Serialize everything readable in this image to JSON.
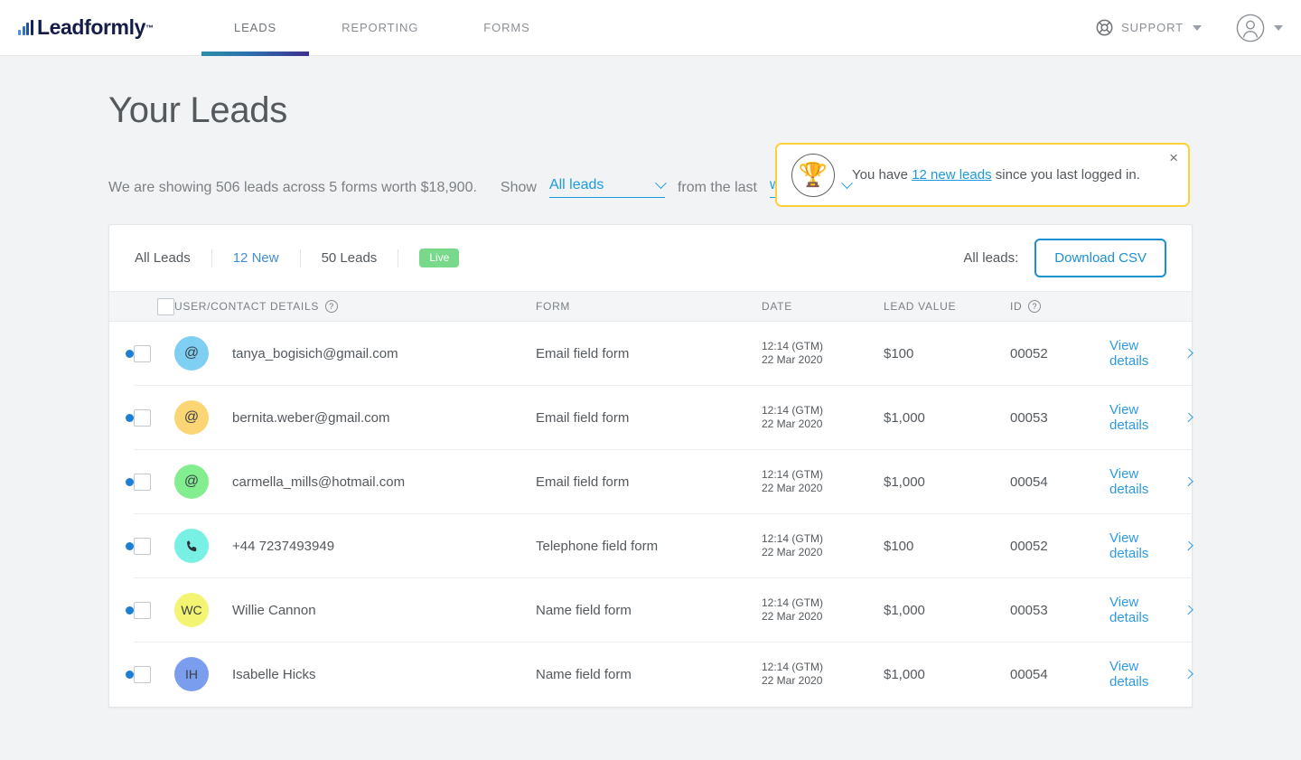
{
  "nav": {
    "logo_text": "Leadformly",
    "logo_tm": "™",
    "items": [
      {
        "label": "LEADS",
        "active": true
      },
      {
        "label": "REPORTING",
        "active": false
      },
      {
        "label": "FORMS",
        "active": false
      }
    ],
    "support_label": "SUPPORT"
  },
  "header": {
    "title": "Your Leads"
  },
  "banner": {
    "icon": "trophy-icon",
    "icon_glyph": "🏆",
    "text_before": "You have",
    "link_text": "12 new leads",
    "text_after": "since you last logged in.",
    "close_glyph": "×",
    "border_color": "#ffd037"
  },
  "filters": {
    "summary": "We are showing 506 leads across 5 forms worth $18,900.",
    "show_label": "Show",
    "leads_filter_value": "All leads",
    "from_label": "from the last",
    "period_filter_value": "week"
  },
  "card": {
    "tabs": [
      {
        "label": "All Leads",
        "active": true
      },
      {
        "label": "12 New",
        "active": false
      },
      {
        "label": "50 Leads",
        "active": false
      }
    ],
    "live_badge": "Live",
    "all_leads_label": "All leads:",
    "download_label": "Download CSV"
  },
  "table": {
    "headers": {
      "user": "USER/CONTACT DETAILS",
      "form": "FORM",
      "date": "DATE",
      "value": "LEAD VALUE",
      "id": "ID",
      "help_glyph": "?"
    },
    "rows": [
      {
        "unread": true,
        "avatar_type": "email",
        "avatar_glyph": "@",
        "avatar_color": "#7fcff3",
        "contact": "tanya_bogisich@gmail.com",
        "form": "Email field form",
        "time": "12:14 (GTM)",
        "date": "22 Mar 2020",
        "value": "$100",
        "id": "00052",
        "action": "View details"
      },
      {
        "unread": true,
        "avatar_type": "email",
        "avatar_glyph": "@",
        "avatar_color": "#fcd575",
        "contact": "bernita.weber@gmail.com",
        "form": "Email field form",
        "time": "12:14 (GTM)",
        "date": "22 Mar 2020",
        "value": "$1,000",
        "id": "00053",
        "action": "View details"
      },
      {
        "unread": true,
        "avatar_type": "email",
        "avatar_glyph": "@",
        "avatar_color": "#82ee8f",
        "contact": "carmella_mills@hotmail.com",
        "form": "Email field form",
        "time": "12:14 (GTM)",
        "date": "22 Mar 2020",
        "value": "$1,000",
        "id": "00054",
        "action": "View details"
      },
      {
        "unread": true,
        "avatar_type": "phone",
        "avatar_glyph": "☎",
        "avatar_color": "#78f0e3",
        "contact": "+44 7237493949",
        "form": "Telephone field form",
        "time": "12:14 (GTM)",
        "date": "22 Mar 2020",
        "value": "$100",
        "id": "00052",
        "action": "View details"
      },
      {
        "unread": true,
        "avatar_type": "initials",
        "avatar_glyph": "WC",
        "avatar_color": "#f2f472",
        "contact": "Willie Cannon",
        "form": "Name field form",
        "time": "12:14 (GTM)",
        "date": "22 Mar 2020",
        "value": "$1,000",
        "id": "00053",
        "action": "View details"
      },
      {
        "unread": true,
        "avatar_type": "initials",
        "avatar_glyph": "IH",
        "avatar_color": "#7b9ded",
        "contact": "Isabelle Hicks",
        "form": "Name field form",
        "time": "12:14 (GTM)",
        "date": "22 Mar 2020",
        "value": "$1,000",
        "id": "00054",
        "action": "View details"
      }
    ]
  }
}
